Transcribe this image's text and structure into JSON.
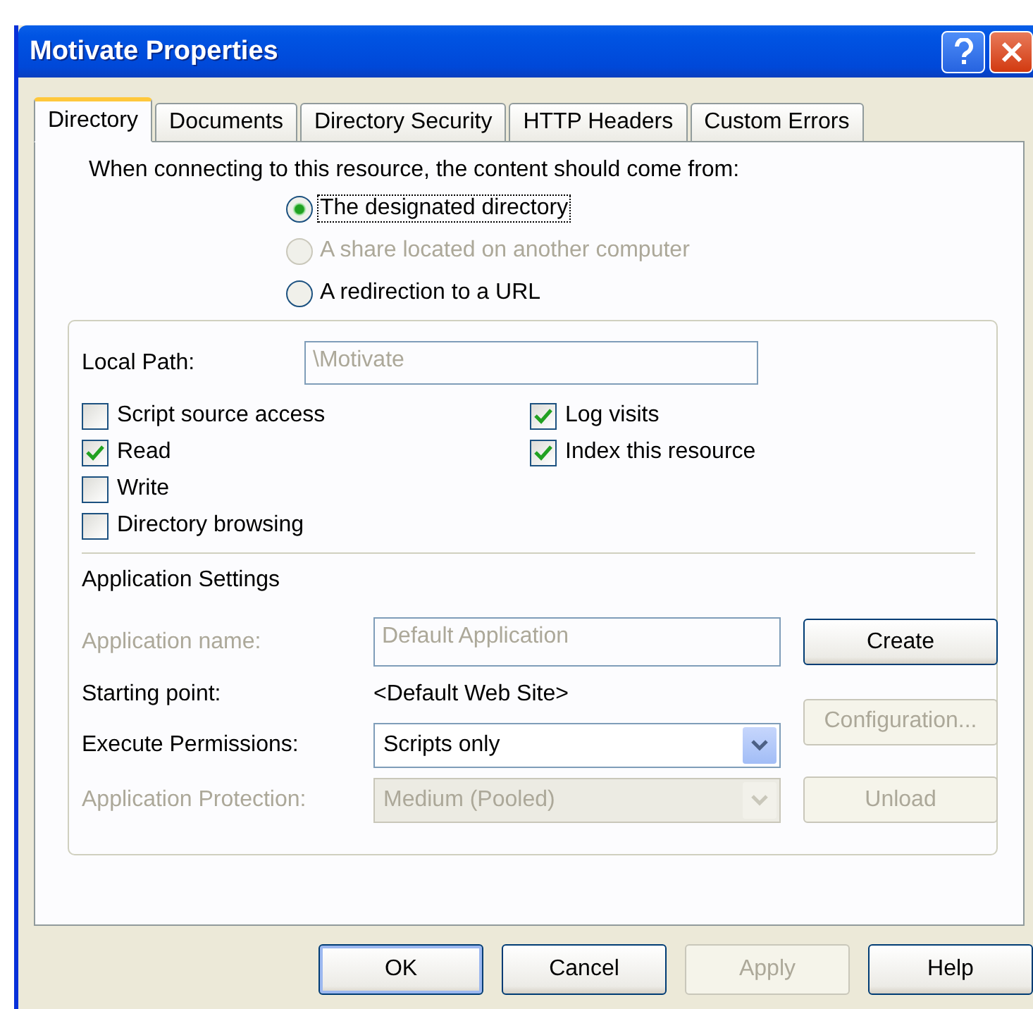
{
  "window": {
    "title": "Motivate Properties"
  },
  "tabs": [
    {
      "label": "Directory",
      "selected": true
    },
    {
      "label": "Documents",
      "selected": false
    },
    {
      "label": "Directory Security",
      "selected": false
    },
    {
      "label": "HTTP Headers",
      "selected": false
    },
    {
      "label": "Custom Errors",
      "selected": false
    }
  ],
  "content_source": {
    "prompt": "When connecting to this resource, the content should come from:",
    "options": [
      {
        "label": "The designated directory",
        "selected": true,
        "disabled": false
      },
      {
        "label": "A share located on another computer",
        "selected": false,
        "disabled": true
      },
      {
        "label": "A redirection to a URL",
        "selected": false,
        "disabled": false
      }
    ]
  },
  "local_path": {
    "label": "Local Path:",
    "value": "\\Motivate",
    "disabled": true
  },
  "permissions": {
    "left": [
      {
        "label": "Script source access",
        "checked": false
      },
      {
        "label": "Read",
        "checked": true
      },
      {
        "label": "Write",
        "checked": false
      },
      {
        "label": "Directory browsing",
        "checked": false
      }
    ],
    "right": [
      {
        "label": "Log visits",
        "checked": true
      },
      {
        "label": "Index this resource",
        "checked": true
      }
    ]
  },
  "application_settings": {
    "heading": "Application Settings",
    "rows": [
      {
        "kind": "field",
        "label": "Application name:",
        "value": "Default Application",
        "disabled": true,
        "button": {
          "label": "Create",
          "disabled": false
        }
      },
      {
        "kind": "text",
        "label": "Starting point:",
        "value": "<Default Web Site>",
        "disabled": false,
        "button": {
          "label": "Configuration...",
          "disabled": true
        }
      },
      {
        "kind": "select",
        "label": "Execute Permissions:",
        "value": "Scripts only",
        "disabled": false
      },
      {
        "kind": "select",
        "label": "Application Protection:",
        "value": "Medium (Pooled)",
        "disabled": true,
        "button": {
          "label": "Unload",
          "disabled": true
        }
      }
    ]
  },
  "buttons": [
    {
      "label": "OK",
      "default": true,
      "disabled": false
    },
    {
      "label": "Cancel",
      "default": false,
      "disabled": false
    },
    {
      "label": "Apply",
      "default": false,
      "disabled": true
    },
    {
      "label": "Help",
      "default": false,
      "disabled": false
    }
  ]
}
